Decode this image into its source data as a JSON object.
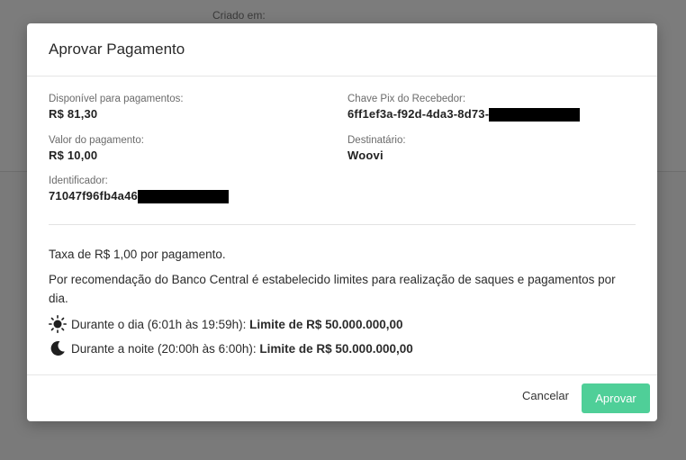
{
  "background": {
    "label": "Criado em:"
  },
  "modal": {
    "title": "Aprovar Pagamento",
    "fields": {
      "available_label": "Disponível para pagamentos:",
      "available_value": "R$ 81,30",
      "pix_key_label": "Chave Pix do Recebedor:",
      "pix_key_value": "6ff1ef3a-f92d-4da3-8d73-",
      "amount_label": "Valor do pagamento:",
      "amount_value": "R$ 10,00",
      "recipient_label": "Destinatário:",
      "recipient_value": "Woovi",
      "identifier_label": "Identificador:",
      "identifier_value": "71047f96fb4a46"
    },
    "notes": {
      "fee": "Taxa de R$ 1,00 por pagamento.",
      "recommendation": "Por recomendação do Banco Central é estabelecido limites para realização de saques e pagamentos por dia.",
      "day_text": "Durante o dia (6:01h às 19:59h): ",
      "day_limit": "Limite de R$ 50.000.000,00",
      "day_icon": "sun-icon",
      "night_text": "Durante a noite (20:00h às 6:00h): ",
      "night_limit": "Limite de R$ 50.000.000,00",
      "night_icon": "moon-icon"
    },
    "footer": {
      "cancel_label": "Cancelar",
      "approve_label": "Aprovar"
    }
  },
  "colors": {
    "accent": "#4fcf98",
    "overlay": "#7a7a7a"
  }
}
